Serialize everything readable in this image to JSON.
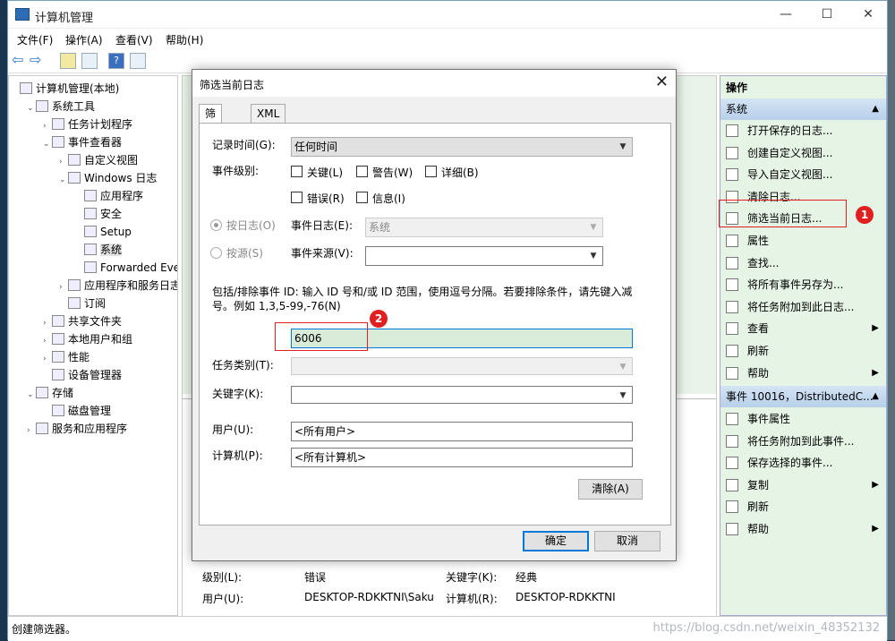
{
  "window": {
    "title": "计算机管理"
  },
  "menu": [
    "文件(F)",
    "操作(A)",
    "查看(V)",
    "帮助(H)"
  ],
  "tree": {
    "items": [
      {
        "label": "计算机管理(本地)",
        "level": 0,
        "exp": ""
      },
      {
        "label": "系统工具",
        "level": 1,
        "exp": "v"
      },
      {
        "label": "任务计划程序",
        "level": 2,
        "exp": ">"
      },
      {
        "label": "事件查看器",
        "level": 2,
        "exp": "v"
      },
      {
        "label": "自定义视图",
        "level": 3,
        "exp": ">"
      },
      {
        "label": "Windows 日志",
        "level": 3,
        "exp": "v"
      },
      {
        "label": "应用程序",
        "level": 4,
        "exp": ""
      },
      {
        "label": "安全",
        "level": 4,
        "exp": ""
      },
      {
        "label": "Setup",
        "level": 4,
        "exp": ""
      },
      {
        "label": "系统",
        "level": 4,
        "exp": "",
        "selected": true
      },
      {
        "label": "Forwarded Eve",
        "level": 4,
        "exp": ""
      },
      {
        "label": "应用程序和服务日志",
        "level": 3,
        "exp": ">"
      },
      {
        "label": "订阅",
        "level": 3,
        "exp": ""
      },
      {
        "label": "共享文件夹",
        "level": 2,
        "exp": ">"
      },
      {
        "label": "本地用户和组",
        "level": 2,
        "exp": ">"
      },
      {
        "label": "性能",
        "level": 2,
        "exp": ">"
      },
      {
        "label": "设备管理器",
        "level": 2,
        "exp": ""
      },
      {
        "label": "存储",
        "level": 1,
        "exp": "v"
      },
      {
        "label": "磁盘管理",
        "level": 2,
        "exp": ""
      },
      {
        "label": "服务和应用程序",
        "level": 1,
        "exp": ">"
      }
    ]
  },
  "details": {
    "level_label": "级别(L):",
    "level_value": "错误",
    "keyword_label": "关键字(K):",
    "keyword_value": "经典",
    "user_label": "用户(U):",
    "user_value": "DESKTOP-RDKKTNI\\Saku",
    "computer_label": "计算机(R):",
    "computer_value": "DESKTOP-RDKKTNI"
  },
  "actions": {
    "header": "操作",
    "section1": "系统",
    "items1": [
      {
        "label": "打开保存的日志...",
        "sub": ""
      },
      {
        "label": "创建自定义视图...",
        "sub": ""
      },
      {
        "label": "导入自定义视图...",
        "sub": ""
      },
      {
        "label": "清除日志...",
        "sub": ""
      },
      {
        "label": "筛选当前日志...",
        "sub": ""
      },
      {
        "label": "属性",
        "sub": ""
      },
      {
        "label": "查找...",
        "sub": ""
      },
      {
        "label": "将所有事件另存为...",
        "sub": ""
      },
      {
        "label": "将任务附加到此日志...",
        "sub": ""
      },
      {
        "label": "查看",
        "sub": "▶"
      },
      {
        "label": "刷新",
        "sub": ""
      },
      {
        "label": "帮助",
        "sub": "▶"
      }
    ],
    "section2": "事件 10016，DistributedC...",
    "items2": [
      {
        "label": "事件属性",
        "sub": ""
      },
      {
        "label": "将任务附加到此事件...",
        "sub": ""
      },
      {
        "label": "保存选择的事件...",
        "sub": ""
      },
      {
        "label": "复制",
        "sub": "▶"
      },
      {
        "label": "刷新",
        "sub": ""
      },
      {
        "label": "帮助",
        "sub": "▶"
      }
    ]
  },
  "annotations": {
    "badge1": "1",
    "badge2": "2"
  },
  "status": {
    "text": "创建筛选器。",
    "watermark": "https://blog.csdn.net/weixin_48352132"
  },
  "dialog": {
    "title": "筛选当前日志",
    "tabs": [
      "筛选器",
      "XML"
    ],
    "logged_label": "记录时间(G):",
    "logged_value": "任何时间",
    "level_label": "事件级别:",
    "levels": [
      "关键(L)",
      "警告(W)",
      "详细(B)",
      "错误(R)",
      "信息(I)"
    ],
    "by_log_label": "按日志(O)",
    "by_source_label": "按源(S)",
    "event_logs_label": "事件日志(E):",
    "event_logs_value": "系统",
    "event_sources_label": "事件来源(V):",
    "event_sources_value": "",
    "desc": "包括/排除事件 ID: 输入 ID 号和/或 ID 范围，使用逗号分隔。若要排除条件，请先键入减号。例如 1,3,5-99,-76(N)",
    "event_id_value": "6006",
    "task_label": "任务类别(T):",
    "keywords_label": "关键字(K):",
    "user_label": "用户(U):",
    "user_value": "<所有用户>",
    "computer_label": "计算机(P):",
    "computer_value": "<所有计算机>",
    "clear_button": "清除(A)",
    "ok_button": "确定",
    "cancel_button": "取消"
  }
}
